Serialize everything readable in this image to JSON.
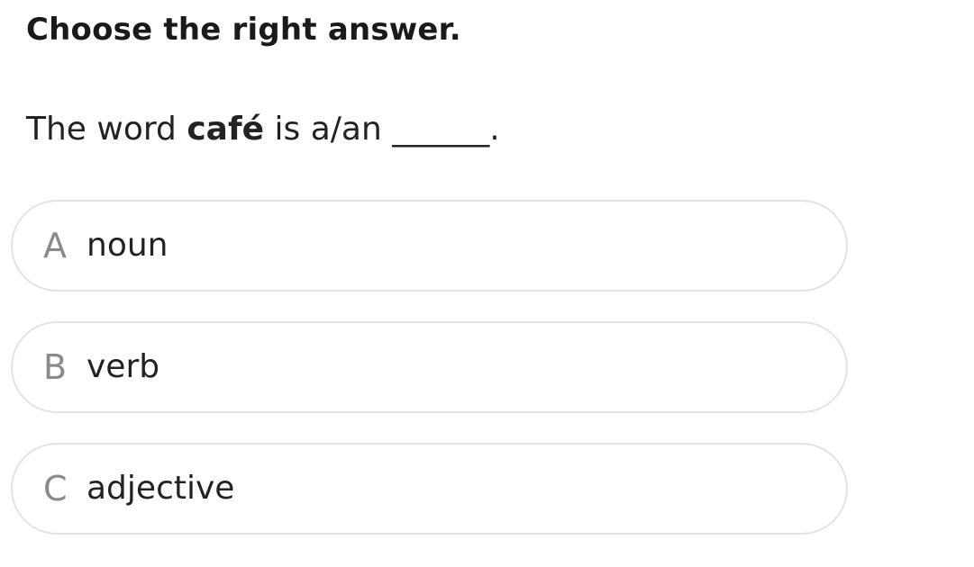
{
  "instruction": "Choose the right answer.",
  "question": {
    "prefix": "The word ",
    "keyword": "café",
    "suffix": " is a/an ______."
  },
  "options": [
    {
      "letter": "A",
      "text": "noun"
    },
    {
      "letter": "B",
      "text": "verb"
    },
    {
      "letter": "C",
      "text": "adjective"
    }
  ]
}
